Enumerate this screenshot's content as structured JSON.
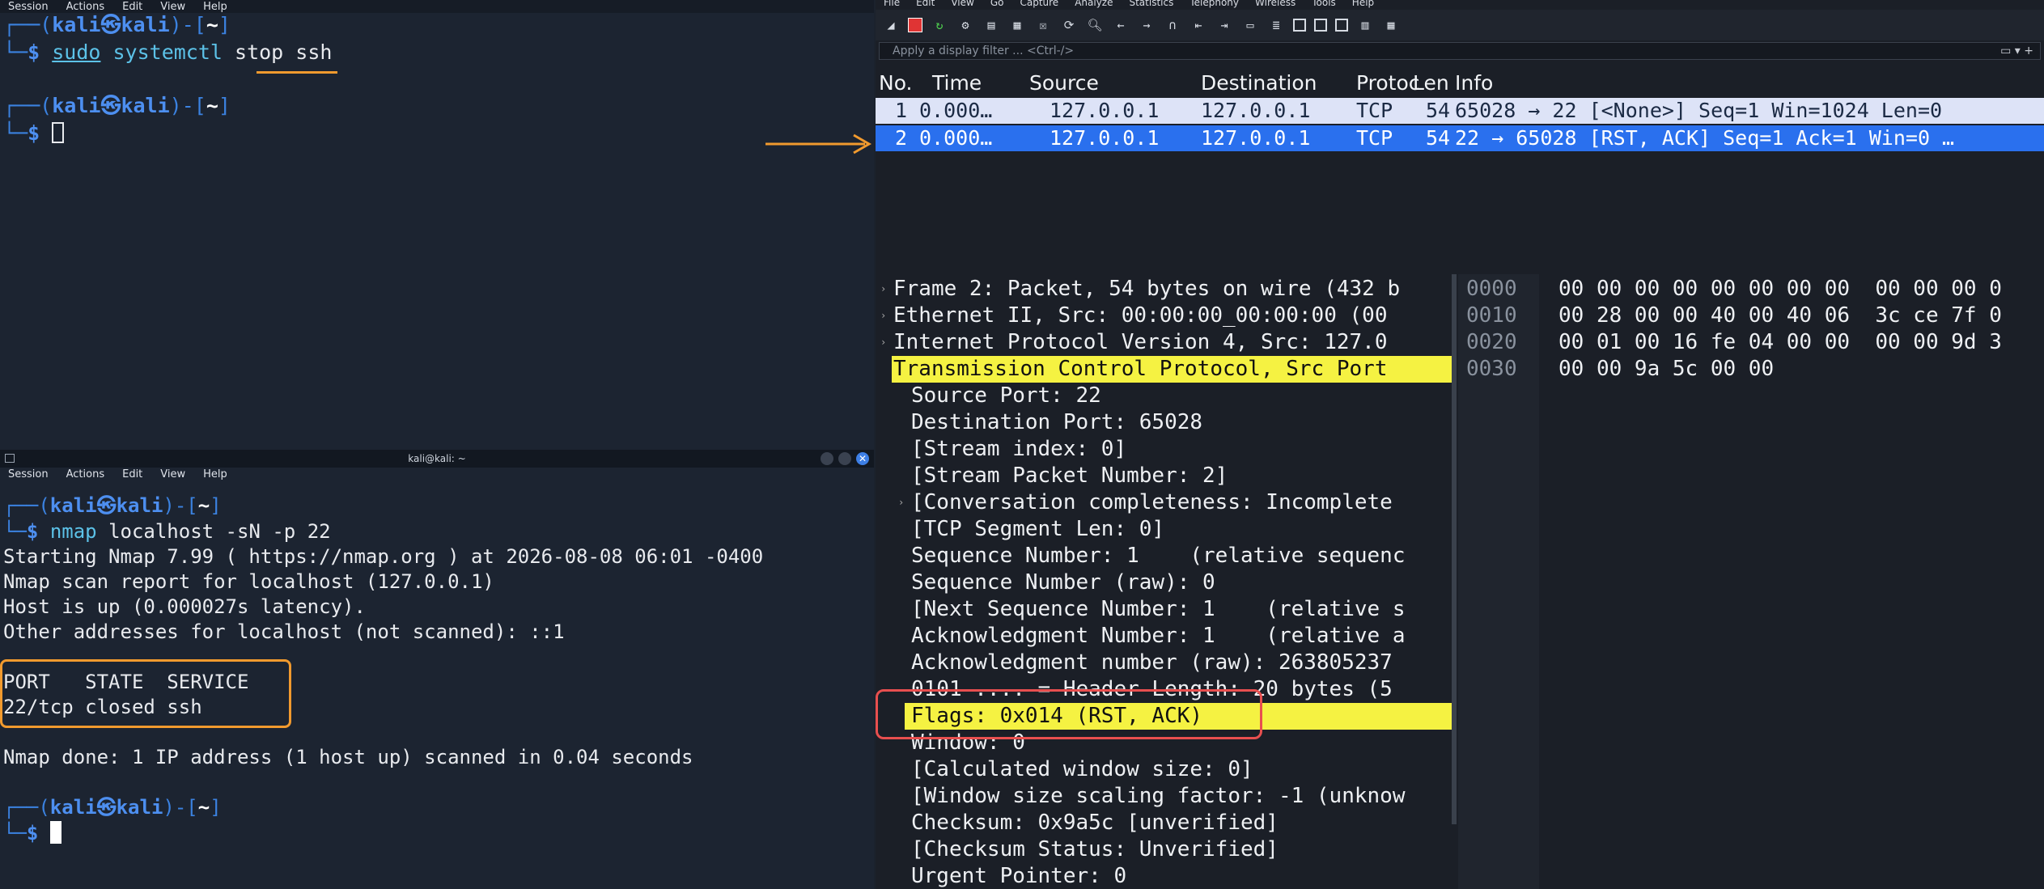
{
  "terminal_top": {
    "menu": [
      "Session",
      "Actions",
      "Edit",
      "View",
      "Help"
    ],
    "prompt_user": "kali",
    "prompt_host": "kali",
    "prompt_path": "~",
    "cmd1": {
      "sudo": "sudo",
      "prog": "systemctl",
      "args": "stop ssh"
    }
  },
  "terminal_bottom": {
    "title": "kali@kali: ~",
    "menu": [
      "Session",
      "Actions",
      "Edit",
      "View",
      "Help"
    ],
    "cmd": {
      "prog": "nmap",
      "args": "localhost -sN -p 22"
    },
    "output": [
      "Starting Nmap 7.99 ( https://nmap.org ) at 2026-08-08 06:01 -0400",
      "Nmap scan report for localhost (127.0.0.1)",
      "Host is up (0.000027s latency).",
      "Other addresses for localhost (not scanned): ::1"
    ],
    "table_header": "PORT   STATE  SERVICE",
    "table_row": "22/tcp closed ssh",
    "done": "Nmap done: 1 IP address (1 host up) scanned in 0.04 seconds"
  },
  "wireshark": {
    "menu": [
      "File",
      "Edit",
      "View",
      "Go",
      "Capture",
      "Analyze",
      "Statistics",
      "Telephony",
      "Wireless",
      "Tools",
      "Help"
    ],
    "filter_placeholder": "Apply a display filter ... <Ctrl-/>",
    "columns": [
      "No.",
      "Time",
      "Source",
      "Destination",
      "Protoc",
      "Len",
      "Info"
    ],
    "packets": [
      {
        "no": "1",
        "time": "0.000…",
        "src": "127.0.0.1",
        "dst": "127.0.0.1",
        "proto": "TCP",
        "len": "54",
        "info": "65028 → 22 [<None>] Seq=1 Win=1024 Len=0"
      },
      {
        "no": "2",
        "time": "0.000…",
        "src": "127.0.0.1",
        "dst": "127.0.0.1",
        "proto": "TCP",
        "len": "54",
        "info": "22 → 65028 [RST, ACK] Seq=1 Ack=1 Win=0 …"
      }
    ],
    "details": [
      "Frame 2: Packet, 54 bytes on wire (432 b",
      "Ethernet II, Src: 00:00:00_00:00:00 (00",
      "Internet Protocol Version 4, Src: 127.0",
      "Transmission Control Protocol, Src Port",
      "Source Port: 22",
      "Destination Port: 65028",
      "[Stream index: 0]",
      "[Stream Packet Number: 2]",
      "[Conversation completeness: Incomplete",
      "[TCP Segment Len: 0]",
      "Sequence Number: 1    (relative sequenc",
      "Sequence Number (raw): 0",
      "[Next Sequence Number: 1    (relative s",
      "Acknowledgment Number: 1    (relative a",
      "Acknowledgment number (raw): 263805237",
      "0101 .... = Header Length: 20 bytes (5",
      "Flags: 0x014 (RST, ACK)",
      "Window: 0",
      "[Calculated window size: 0]",
      "[Window size scaling factor: -1 (unknow",
      "Checksum: 0x9a5c [unverified]",
      "[Checksum Status: Unverified]",
      "Urgent Pointer: 0"
    ],
    "hex": [
      {
        "off": "0000",
        "bytes": "00 00 00 00 00 00 00 00  00 00 00 0"
      },
      {
        "off": "0010",
        "bytes": "00 28 00 00 40 00 40 06  3c ce 7f 0"
      },
      {
        "off": "0020",
        "bytes": "00 01 00 16 fe 04 00 00  00 00 9d 3"
      },
      {
        "off": "0030",
        "bytes": "00 00 9a 5c 00 00"
      }
    ]
  },
  "colors": {
    "annotation_orange": "#f19a2e",
    "annotation_red": "#e84f4f",
    "selected_row": "#2a70ee",
    "highlight_yellow": "#f5f242"
  }
}
